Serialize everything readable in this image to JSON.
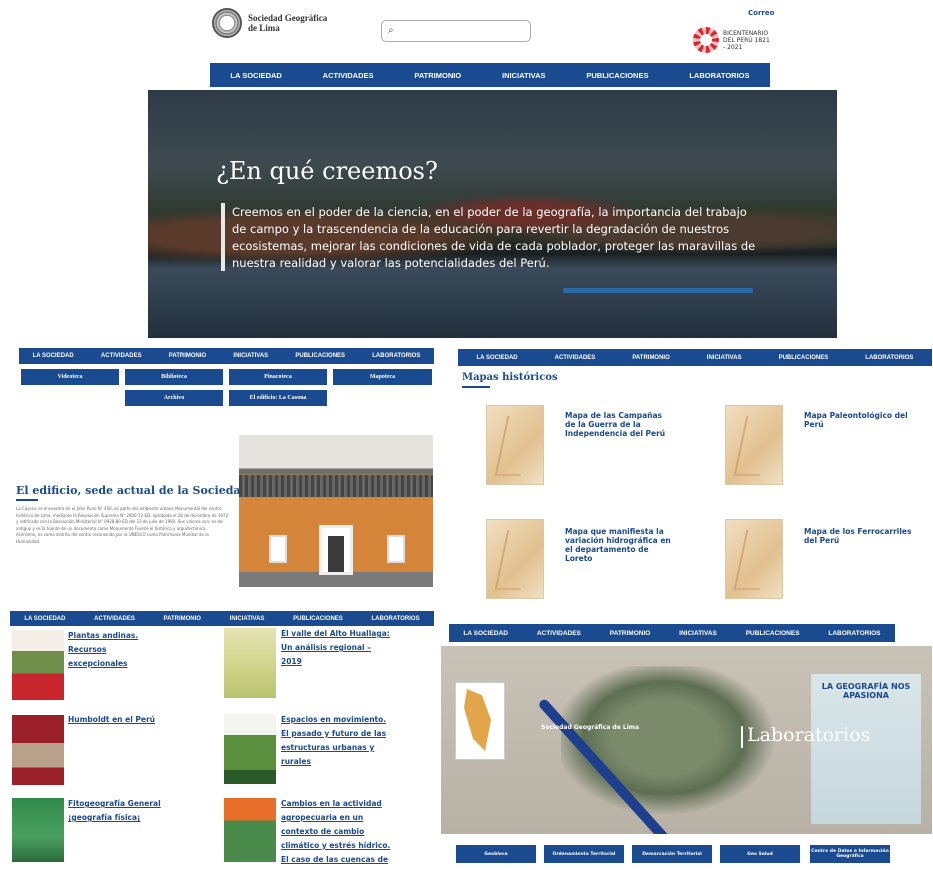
{
  "header": {
    "org_name": "Sociedad Geográfica de Lima",
    "search_placeholder": "",
    "correo": "Correo",
    "bicentennial": "BICENTENARIO DEL PERÚ 1821 - 2021"
  },
  "nav_items": [
    "LA SOCIEDAD",
    "ACTIVIDADES",
    "PATRIMONIO",
    "INICIATIVAS",
    "PUBLICACIONES",
    "LABORATORIOS"
  ],
  "hero": {
    "title": "¿En qué creemos?",
    "text": "Creemos en el poder de la ciencia, en el poder de la geografía, la importancia del trabajo de campo y la trascendencia de la educación para revertir la degradación de nuestros ecosistemas, mejorar las condiciones de vida de cada poblador, proteger las maravillas de nuestra realidad y valorar las potencialidades del Perú."
  },
  "patrimonio": {
    "tabs": [
      "Videoteca",
      "Biblioteca",
      "Pinacoteca",
      "Mapoteca",
      "Archivo",
      "El edificio: La Casona"
    ],
    "building_title": "El edificio, sede actual de la Sociedad",
    "building_text": "La Casona se encuentra en el Jirón Puno N° 456, es parte del ambiente urbano Monumental del centro histórico de Lima, mediante la Resolución Suprema N° 2900-72-ED, aprobada el 28 de diciembre de 1972 y ratificado con la Resolución Ministerial N° 0928-80-ED del 23 de julio de 1980. Sus valores son: es de antiguo y es la fuente de un documento como Monumento Fuente el histórico y arquitectónico. Asimismo, es como distrito del centro reconocido por la UNESCO como Patrimonio Mundial de la Humanidad."
  },
  "mapoteca": {
    "title": "Mapas históricos",
    "maps": [
      "Mapa de las Campañas de la Guerra de la Independencia del Perú",
      "Mapa Paleontológico del Perú",
      "Mapa que manifiesta la variación hidrográfica en el departamento de Loreto",
      "Mapa de los Ferrocarriles del Perú"
    ]
  },
  "publicaciones": [
    "Plantas andinas. Recursos excepcionales",
    "El valle del Alto Huallaga: Un análisis regional – 2019",
    "Humboldt en el Perú",
    "Espacios en movimiento. El pasado y futuro de las estructuras urbanas y rurales",
    "Fitogeografía General ¡geografía física¡",
    "Cambios en la actividad agropecuaria en un contexto de cambio climático y estrés hídrico. El caso de las cuencas de Ica y Pampas"
  ],
  "laboratorios": {
    "title": "Laboratorios",
    "photo_org": "Sociedad Geográfica de Lima",
    "poster": "LA GEOGRAFÍA NOS APASIONA",
    "buttons": [
      "Geobloca",
      "Ordenamiento Territorial",
      "Demarcación Territorial",
      "Geo Salud",
      "Centro de Datos e Información Geográfica"
    ]
  },
  "colors": {
    "nav": "#1a4a8f",
    "accent_red": "#d7262e"
  }
}
